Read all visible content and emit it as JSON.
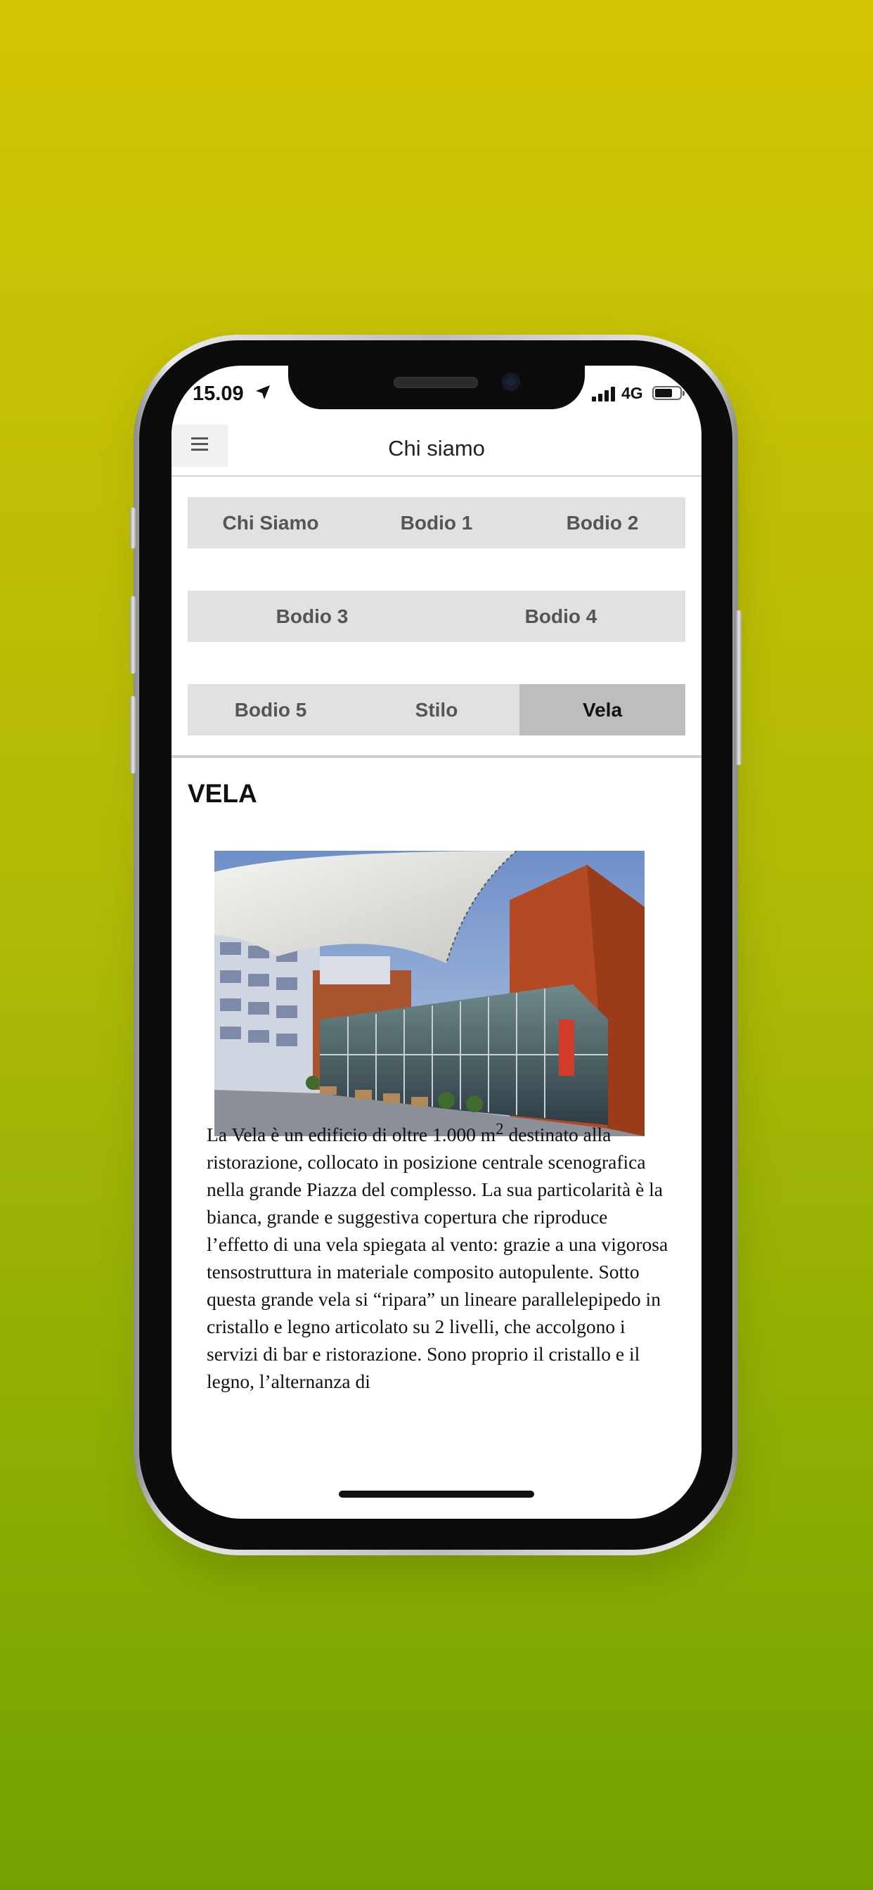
{
  "status_bar": {
    "time": "15.09",
    "network": "4G",
    "battery_level": 0.64,
    "icons": [
      "location-arrow-icon",
      "signal-bars-icon",
      "battery-icon"
    ]
  },
  "nav": {
    "title": "Chi siamo",
    "menu_icon": "hamburger-menu-icon"
  },
  "segments": [
    {
      "items": [
        "Chi Siamo",
        "Bodio 1",
        "Bodio 2"
      ],
      "active": null
    },
    {
      "items": [
        "Bodio 3",
        "Bodio 4"
      ],
      "active": null
    },
    {
      "items": [
        "Bodio 5",
        "Stilo",
        "Vela"
      ],
      "active": "Vela"
    }
  ],
  "content": {
    "title": "VELA",
    "image": "building-photo",
    "paragraph_before_sup": "La Vela è un edificio di oltre 1.000 m",
    "paragraph_sup": "2",
    "paragraph_after_sup": " destinato alla ristorazione, collocato in posizione centrale scenografica nella grande Piazza del complesso. La sua particolarità è la bianca, grande e suggestiva copertura che riproduce l’effetto di una vela spiegata al vento: grazie a una vigorosa tensostruttura in materiale composito autopulente. Sotto questa grande vela si “ripara” un lineare parallelepipedo in cristallo e legno articolato su 2 livelli, che accolgono i servizi di bar e ristorazione. Sono proprio il cristallo e il legno, l’alternanza di"
  },
  "colors": {
    "background_top": "#d2c404",
    "background_bottom": "#73a200",
    "segment_bg": "#e1e1e3",
    "segment_active": "#bdbdbf"
  }
}
